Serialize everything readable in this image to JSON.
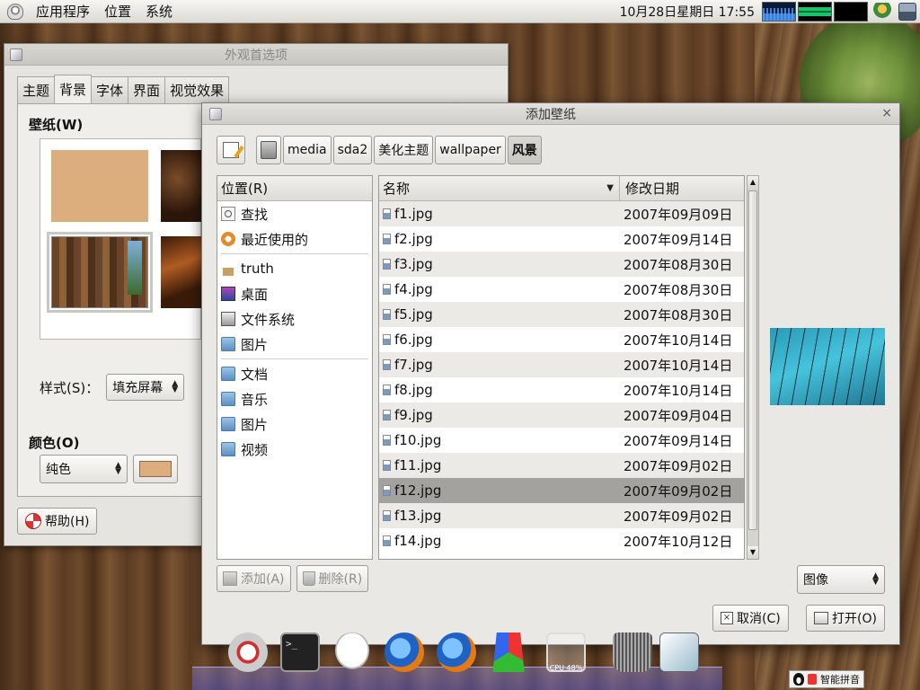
{
  "top_panel": {
    "menus": [
      "应用程序",
      "位置",
      "系统"
    ],
    "clock": "10月28日星期日 17:55",
    "monitors": [
      "cpu-monitor",
      "memory-monitor",
      "net-monitor"
    ]
  },
  "appearance_window": {
    "title": "外观首选项",
    "tabs": [
      "主题",
      "背景",
      "字体",
      "界面",
      "视觉效果"
    ],
    "active_tab": "背景",
    "wallpaper_label": "壁纸(W)",
    "style_label": "样式(S)：",
    "style_value": "填充屏幕",
    "color_label": "颜色(O)",
    "color_mode": "纯色",
    "color_swatch": "#dcae7e",
    "help_button": "帮助(H)"
  },
  "dialog": {
    "title": "添加壁纸",
    "path_buttons": [
      "media",
      "sda2",
      "美化主题",
      "wallpaper",
      "风景"
    ],
    "active_path": "风景",
    "places_header": "位置(R)",
    "places": [
      {
        "label": "查找",
        "icon": "search-icon"
      },
      {
        "label": "最近使用的",
        "icon": "recent-icon"
      },
      {
        "label": "truth",
        "icon": "home-icon"
      },
      {
        "label": "桌面",
        "icon": "desktop-icon"
      },
      {
        "label": "文件系统",
        "icon": "filesystem-icon"
      },
      {
        "label": "图片",
        "icon": "folder-icon"
      },
      {
        "label": "文档",
        "icon": "folder-icon"
      },
      {
        "label": "音乐",
        "icon": "folder-icon"
      },
      {
        "label": "图片",
        "icon": "folder-icon"
      },
      {
        "label": "视频",
        "icon": "folder-icon"
      }
    ],
    "add_button": "添加(A)",
    "remove_button": "删除(R)",
    "columns": {
      "name": "名称",
      "date": "修改日期"
    },
    "files": [
      {
        "name": "f1.jpg",
        "date": "2007年09月09日"
      },
      {
        "name": "f2.jpg",
        "date": "2007年09月14日"
      },
      {
        "name": "f3.jpg",
        "date": "2007年08月30日"
      },
      {
        "name": "f4.jpg",
        "date": "2007年08月30日"
      },
      {
        "name": "f5.jpg",
        "date": "2007年08月30日"
      },
      {
        "name": "f6.jpg",
        "date": "2007年10月14日"
      },
      {
        "name": "f7.jpg",
        "date": "2007年10月14日"
      },
      {
        "name": "f8.jpg",
        "date": "2007年10月14日"
      },
      {
        "name": "f9.jpg",
        "date": "2007年09月04日"
      },
      {
        "name": "f10.jpg",
        "date": "2007年09月14日"
      },
      {
        "name": "f11.jpg",
        "date": "2007年09月02日"
      },
      {
        "name": "f12.jpg",
        "date": "2007年09月02日"
      },
      {
        "name": "f13.jpg",
        "date": "2007年09月02日"
      },
      {
        "name": "f14.jpg",
        "date": "2007年10月12日"
      }
    ],
    "selected_file": "f12.jpg",
    "filter_value": "图像",
    "cancel_button": "取消(C)",
    "open_button": "打开(O)"
  },
  "dock": {
    "items": [
      "safari-icon",
      "terminal-icon",
      "chat-icon",
      "firefox-icon",
      "firefox-icon",
      "color-icon",
      "cpu-monitor-icon",
      "trash-icon",
      "window-switcher-icon"
    ],
    "cpu_label": "CPU 48%"
  },
  "ime": {
    "label": "智能拼音"
  }
}
